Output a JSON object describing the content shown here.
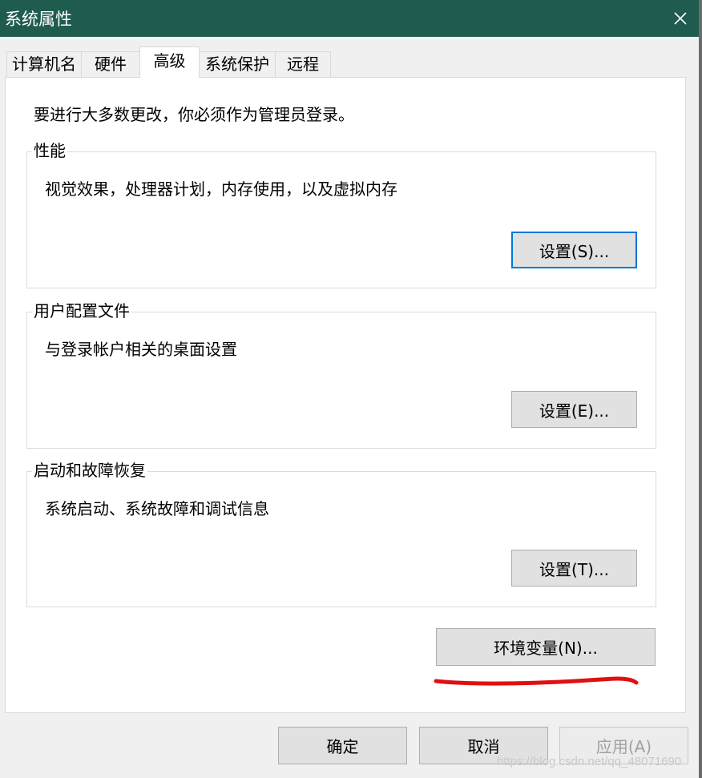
{
  "window": {
    "title": "系统属性",
    "close_label": "✕"
  },
  "tabs": [
    {
      "label": "计算机名",
      "active": false
    },
    {
      "label": "硬件",
      "active": false
    },
    {
      "label": "高级",
      "active": true
    },
    {
      "label": "系统保护",
      "active": false
    },
    {
      "label": "远程",
      "active": false
    }
  ],
  "advanced": {
    "notice": "要进行大多数更改，你必须作为管理员登录。",
    "performance": {
      "legend": "性能",
      "description": "视觉效果，处理器计划，内存使用，以及虚拟内存",
      "button": "设置(S)..."
    },
    "user_profiles": {
      "legend": "用户配置文件",
      "description": "与登录帐户相关的桌面设置",
      "button": "设置(E)..."
    },
    "startup_recovery": {
      "legend": "启动和故障恢复",
      "description": "系统启动、系统故障和调试信息",
      "button": "设置(T)..."
    },
    "env_button": "环境变量(N)..."
  },
  "footer": {
    "ok": "确定",
    "cancel": "取消",
    "apply": "应用(A)"
  },
  "watermark": "https://blog.csdn.net/qq_48071690",
  "colors": {
    "titlebar": "#1f5c4f",
    "focus_border": "#0078d7",
    "annotation_red": "#e01010"
  },
  "icons": {
    "close": "close-icon"
  }
}
